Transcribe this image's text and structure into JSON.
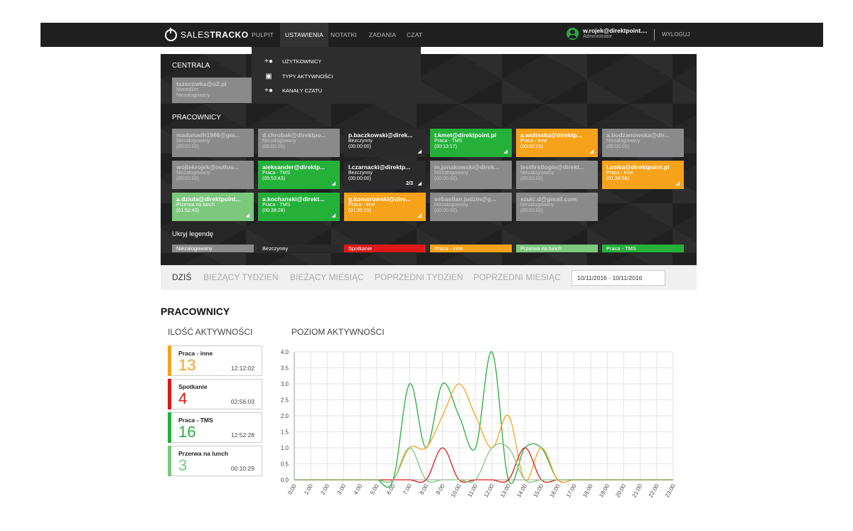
{
  "topbar": {
    "logo_light": "SALES",
    "logo_bold": "TRACKO",
    "nav": [
      "PULPIT",
      "USTAWIENIA",
      "NOTATKI",
      "ZADANIA",
      "CZAT"
    ],
    "user_name": "w.rojek@direktpoint....",
    "user_role": "Administrator",
    "logout": "WYLOGUJ"
  },
  "dropdown": {
    "items": [
      {
        "label": "UŻYTKOWNICY",
        "icon": "add-user-icon"
      },
      {
        "label": "TYPY AKTYWNOŚCI",
        "icon": "activity-type-icon"
      },
      {
        "label": "KANAŁY CZATU",
        "icon": "add-user-icon"
      }
    ]
  },
  "central": {
    "title": "CENTRALA",
    "tile": {
      "email": "tszecowka@o2.pl",
      "role": "Menedżer",
      "status": "Niezalogowany"
    }
  },
  "workers": {
    "title": "PRACOWNICY",
    "tiles": [
      {
        "email": "madanadh1986@gm...",
        "status": "Niezalogowany",
        "time": "(00:00:00)",
        "color": "gray",
        "rss": false
      },
      {
        "email": "d.chrobak@direktpo...",
        "status": "Niezalogowany",
        "time": "(00:00:00)",
        "color": "gray",
        "rss": false
      },
      {
        "email": "p.baczkowski@direk...",
        "status": "Bezczynny",
        "time": "(00:00:00)",
        "color": "dark",
        "rss": true
      },
      {
        "email": "t.kmet@direktpoint.pl",
        "status": "Praca - TMS",
        "time": "(00:13:17)",
        "color": "green",
        "rss": true
      },
      {
        "email": "a.wolinska@direktp...",
        "status": "Praca - inne",
        "time": "(00:02:15)",
        "color": "orange",
        "rss": true
      },
      {
        "email": "a.bodzanowska@dir...",
        "status": "Niezalogowany",
        "time": "(00:00:00)",
        "color": "gray",
        "rss": false
      },
      {
        "email": "wojtekrojek@outloo...",
        "status": "Niezalogowany",
        "time": "(00:00:00)",
        "color": "gray",
        "rss": false
      },
      {
        "email": "aleksander@direktp...",
        "status": "Praca - TMS",
        "time": "(05:53:43)",
        "color": "green",
        "rss": true
      },
      {
        "email": "l.czarnacki@direktp...",
        "status": "Bezczynny",
        "time": "(00:00:00)",
        "color": "dark",
        "rss": true,
        "count": "2/3"
      },
      {
        "email": "m.jonakowski@direk...",
        "status": "Niezalogowany",
        "time": "(00:00:00)",
        "color": "gray",
        "rss": false
      },
      {
        "email": "testfirstlogin@direkt...",
        "status": "Niezalogowany",
        "time": "(00:00:00)",
        "color": "gray",
        "rss": false
      },
      {
        "email": "l.solka@direktpoint.pl",
        "status": "Praca - inne",
        "time": "(01:38:58)",
        "color": "orange",
        "rss": true
      },
      {
        "email": "a.dziula@direktpoint...",
        "status": "Przerwa na lunch",
        "time": "(01:52:43)",
        "color": "light",
        "rss": true
      },
      {
        "email": "a.kochanski@direkt...",
        "status": "Praca - TMS",
        "time": "(00:38:28)",
        "color": "green",
        "rss": true
      },
      {
        "email": "g.komorowski@dire...",
        "status": "Praca - inne",
        "time": "(01:35:15)",
        "color": "orange",
        "rss": true
      },
      {
        "email": "sebastian.judzin@g...",
        "status": "Niezalogowany",
        "time": "(00:00:00)",
        "color": "gray",
        "rss": false
      },
      {
        "email": "szulc.d@gmail.com",
        "status": "Niezalogowany",
        "time": "(00:00:00)",
        "color": "gray",
        "rss": false
      }
    ]
  },
  "legend": {
    "toggle": "Ukryj legendę",
    "items": [
      {
        "label": "Niezalogowany",
        "color": "#8a8a8a"
      },
      {
        "label": "Bezczynny",
        "color": "#2a2a2a"
      },
      {
        "label": "Spotkanie",
        "color": "#e01818"
      },
      {
        "label": "Praca - inne",
        "color": "#f7a21b"
      },
      {
        "label": "Przerwa na lunch",
        "color": "#7cc87d"
      },
      {
        "label": "Praca - TMS",
        "color": "#25b03a"
      }
    ]
  },
  "date_tabs": [
    "DZIŚ",
    "BIEŻĄCY TYDZIEŃ",
    "BIEŻĄCY MIESIĄC",
    "POPRZEDNI TYDZIEŃ",
    "POPRZEDNI MIESIĄC"
  ],
  "date_range": "10/11/2016 - 10/11/2016",
  "section_title": "PRACOWNICY",
  "count_title": "ILOŚĆ AKTYWNOŚCI",
  "level_title": "POZIOM AKTYWNOŚCI",
  "stats": [
    {
      "label": "Praca - inne",
      "value": "13",
      "time": "12:12:02",
      "color": "#f7a21b"
    },
    {
      "label": "Spotkanie",
      "value": "4",
      "time": "02:56:03",
      "color": "#e01818"
    },
    {
      "label": "Praca - TMS",
      "value": "16",
      "time": "12:52:28",
      "color": "#25b03a"
    },
    {
      "label": "Przerwa na lunch",
      "value": "3",
      "time": "00:10:29",
      "color": "#7cc87d"
    }
  ],
  "chart_data": {
    "type": "line",
    "x": [
      "0:00",
      "1:00",
      "2:00",
      "3:00",
      "4:00",
      "5:00",
      "6:00",
      "7:00",
      "8:00",
      "9:00",
      "10:00",
      "11:00",
      "12:00",
      "13:00",
      "14:00",
      "15:00",
      "16:00",
      "17:00",
      "18:00",
      "19:00",
      "20:00",
      "21:00",
      "22:00",
      "23:00"
    ],
    "ylim": [
      0,
      4
    ],
    "yticks": [
      "0.0",
      "0.5",
      "1.0",
      "1.5",
      "2.0",
      "2.5",
      "3.0",
      "3.5",
      "4.0"
    ],
    "grid": true,
    "series": [
      {
        "color": "#25b03a",
        "values": [
          0,
          0,
          0,
          0,
          0,
          0,
          0,
          3,
          1,
          3,
          2,
          1,
          4,
          0,
          1,
          1,
          0,
          0,
          0,
          0,
          0,
          0,
          0,
          0
        ]
      },
      {
        "color": "#f7a21b",
        "values": [
          0,
          0,
          0,
          0,
          0,
          0,
          0,
          1,
          1,
          2,
          3,
          2,
          1,
          2,
          0,
          1,
          0,
          0,
          0,
          0,
          0,
          0,
          0,
          0
        ]
      },
      {
        "color": "#e01818",
        "values": [
          0,
          0,
          0,
          0,
          0,
          0,
          0,
          0,
          0,
          1,
          0,
          0,
          0,
          0,
          1,
          0,
          0,
          0,
          0,
          0,
          0,
          0,
          0,
          0
        ]
      },
      {
        "color": "#7cc87d",
        "values": [
          0,
          0,
          0,
          0,
          0,
          0,
          0,
          1,
          0,
          0,
          0,
          0,
          1,
          1,
          0,
          0,
          0,
          0,
          0,
          0,
          0,
          0,
          0,
          0
        ]
      }
    ]
  }
}
